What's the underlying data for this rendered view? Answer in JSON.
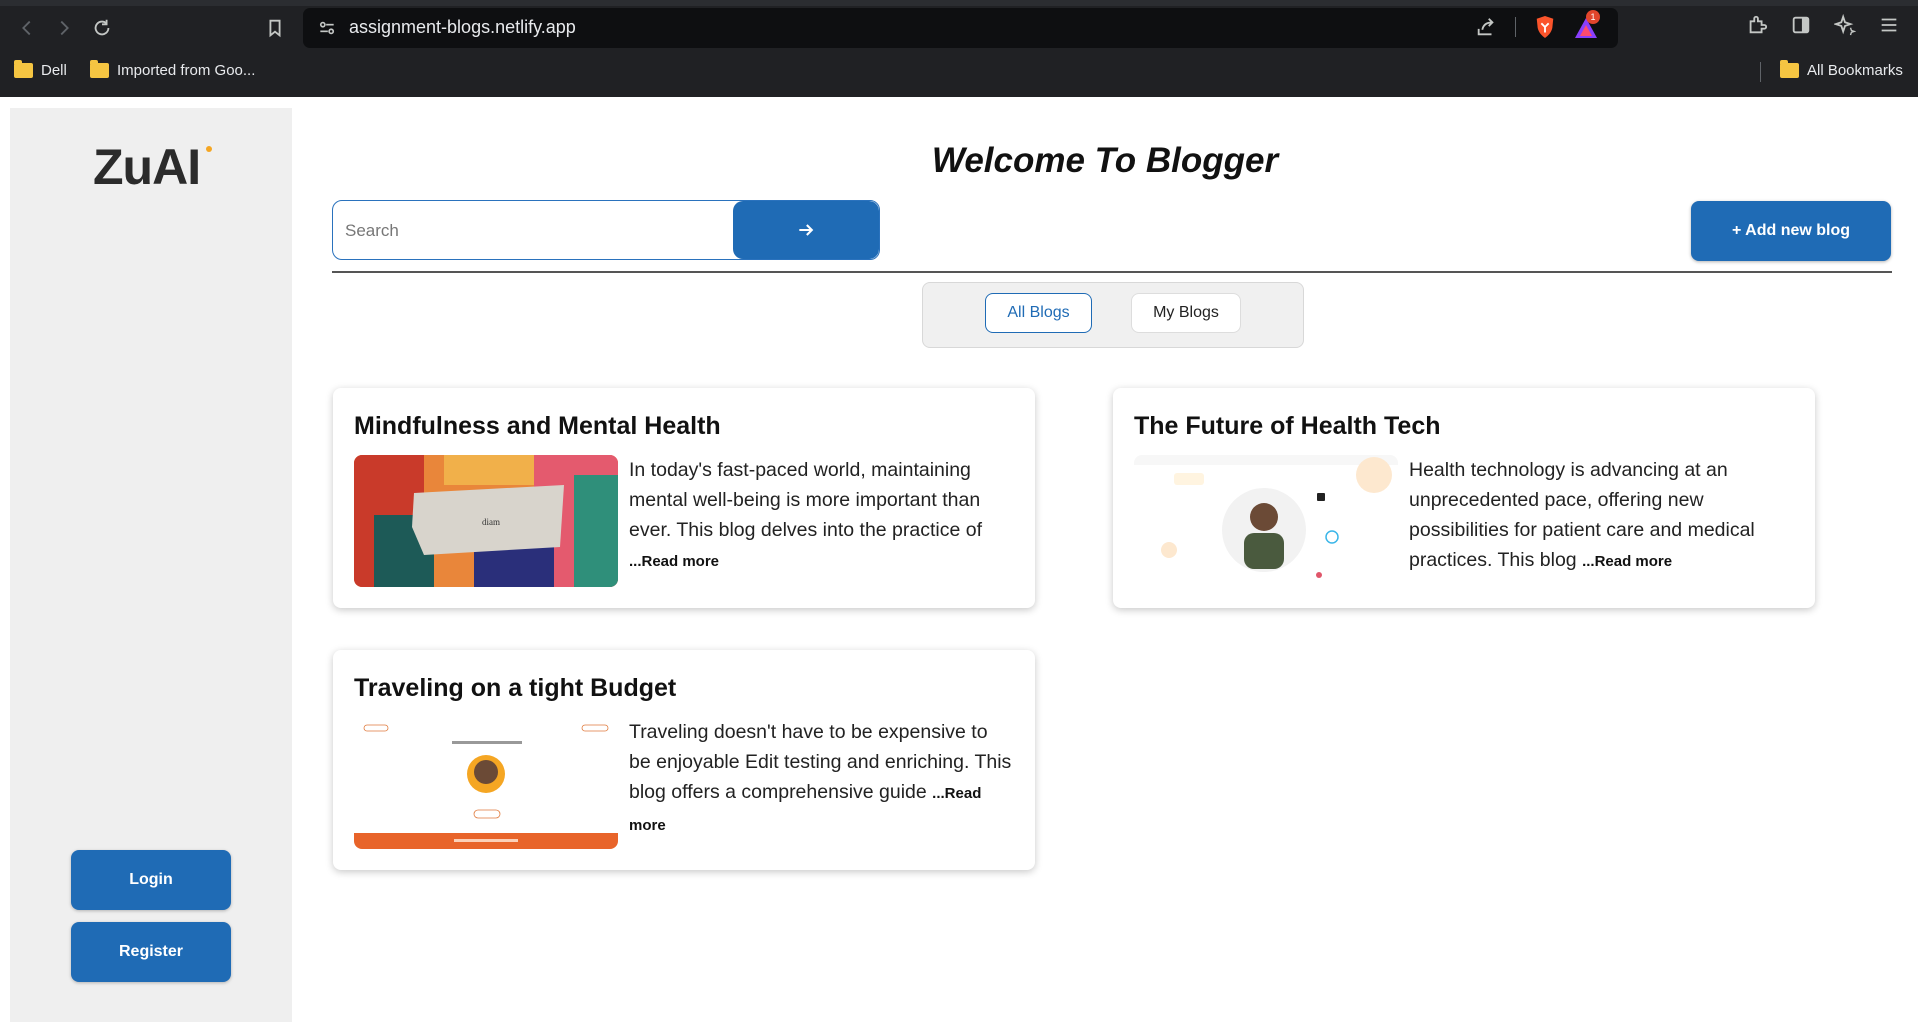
{
  "browser": {
    "url": "assignment-blogs.netlify.app",
    "bookmarks": [
      "Dell",
      "Imported from Goo..."
    ],
    "all_bookmarks": "All Bookmarks",
    "notification_count": "1"
  },
  "sidebar": {
    "logo": "ZuAI",
    "login_label": "Login",
    "register_label": "Register"
  },
  "header": {
    "title": "Welcome To Blogger",
    "search_placeholder": "Search",
    "add_label": "+ Add new blog"
  },
  "tabs": [
    "All Blogs",
    "My Blogs"
  ],
  "blogs": [
    {
      "title": "Mindfulness and Mental Health",
      "excerpt": "In today's fast-paced world, maintaining mental well-being is more important than ever. This blog delves into the practice of ",
      "read_more": "...Read more"
    },
    {
      "title": "The Future of Health Tech",
      "excerpt": "Health technology is advancing at an unprecedented pace, offering new possibilities for patient care and medical practices. This blog ",
      "read_more": "...Read more"
    },
    {
      "title": "Traveling on a tight Budget",
      "excerpt": "Traveling doesn't have to be expensive to be enjoyable Edit testing and enriching. This blog offers a comprehensive guide ",
      "read_more": "...Read more"
    }
  ],
  "colors": {
    "primary": "#1f6bb5",
    "sidebar_bg": "#efefef",
    "chrome_bg": "#202124"
  }
}
